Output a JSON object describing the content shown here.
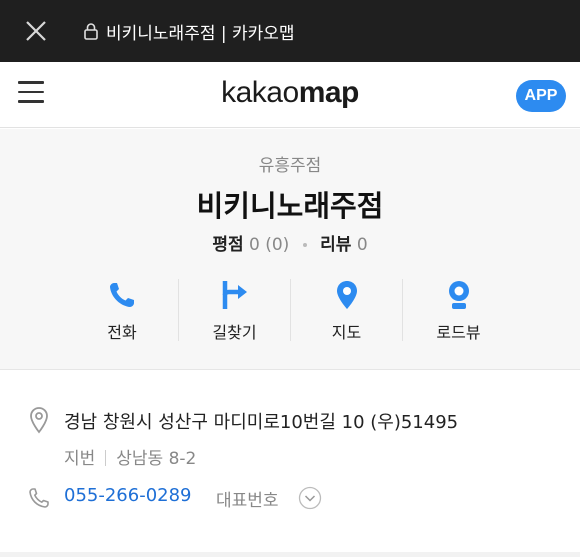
{
  "browser": {
    "title": "비키니노래주점 | 카카오맵"
  },
  "header": {
    "logo_part1": "kakao",
    "logo_part2": "map",
    "app_button": "APP"
  },
  "place": {
    "category": "유흥주점",
    "name": "비키니노래주점",
    "rating_label": "평점",
    "rating_value": "0 (0)",
    "review_label": "리뷰",
    "review_value": "0"
  },
  "actions": [
    {
      "label": "전화",
      "icon": "phone-icon"
    },
    {
      "label": "길찾기",
      "icon": "directions-icon"
    },
    {
      "label": "지도",
      "icon": "map-pin-icon"
    },
    {
      "label": "로드뷰",
      "icon": "roadview-icon"
    }
  ],
  "info": {
    "address": "경남 창원시 성산구 마디미로10번길 10 (우)51495",
    "jibun_label": "지번",
    "jibun_value": "상남동 8-2",
    "phone": "055-266-0289",
    "phone_label": "대표번호"
  },
  "colors": {
    "accent": "#2d8bf0",
    "phone_link": "#1e6fd6",
    "topbar": "#1f1f1f"
  }
}
